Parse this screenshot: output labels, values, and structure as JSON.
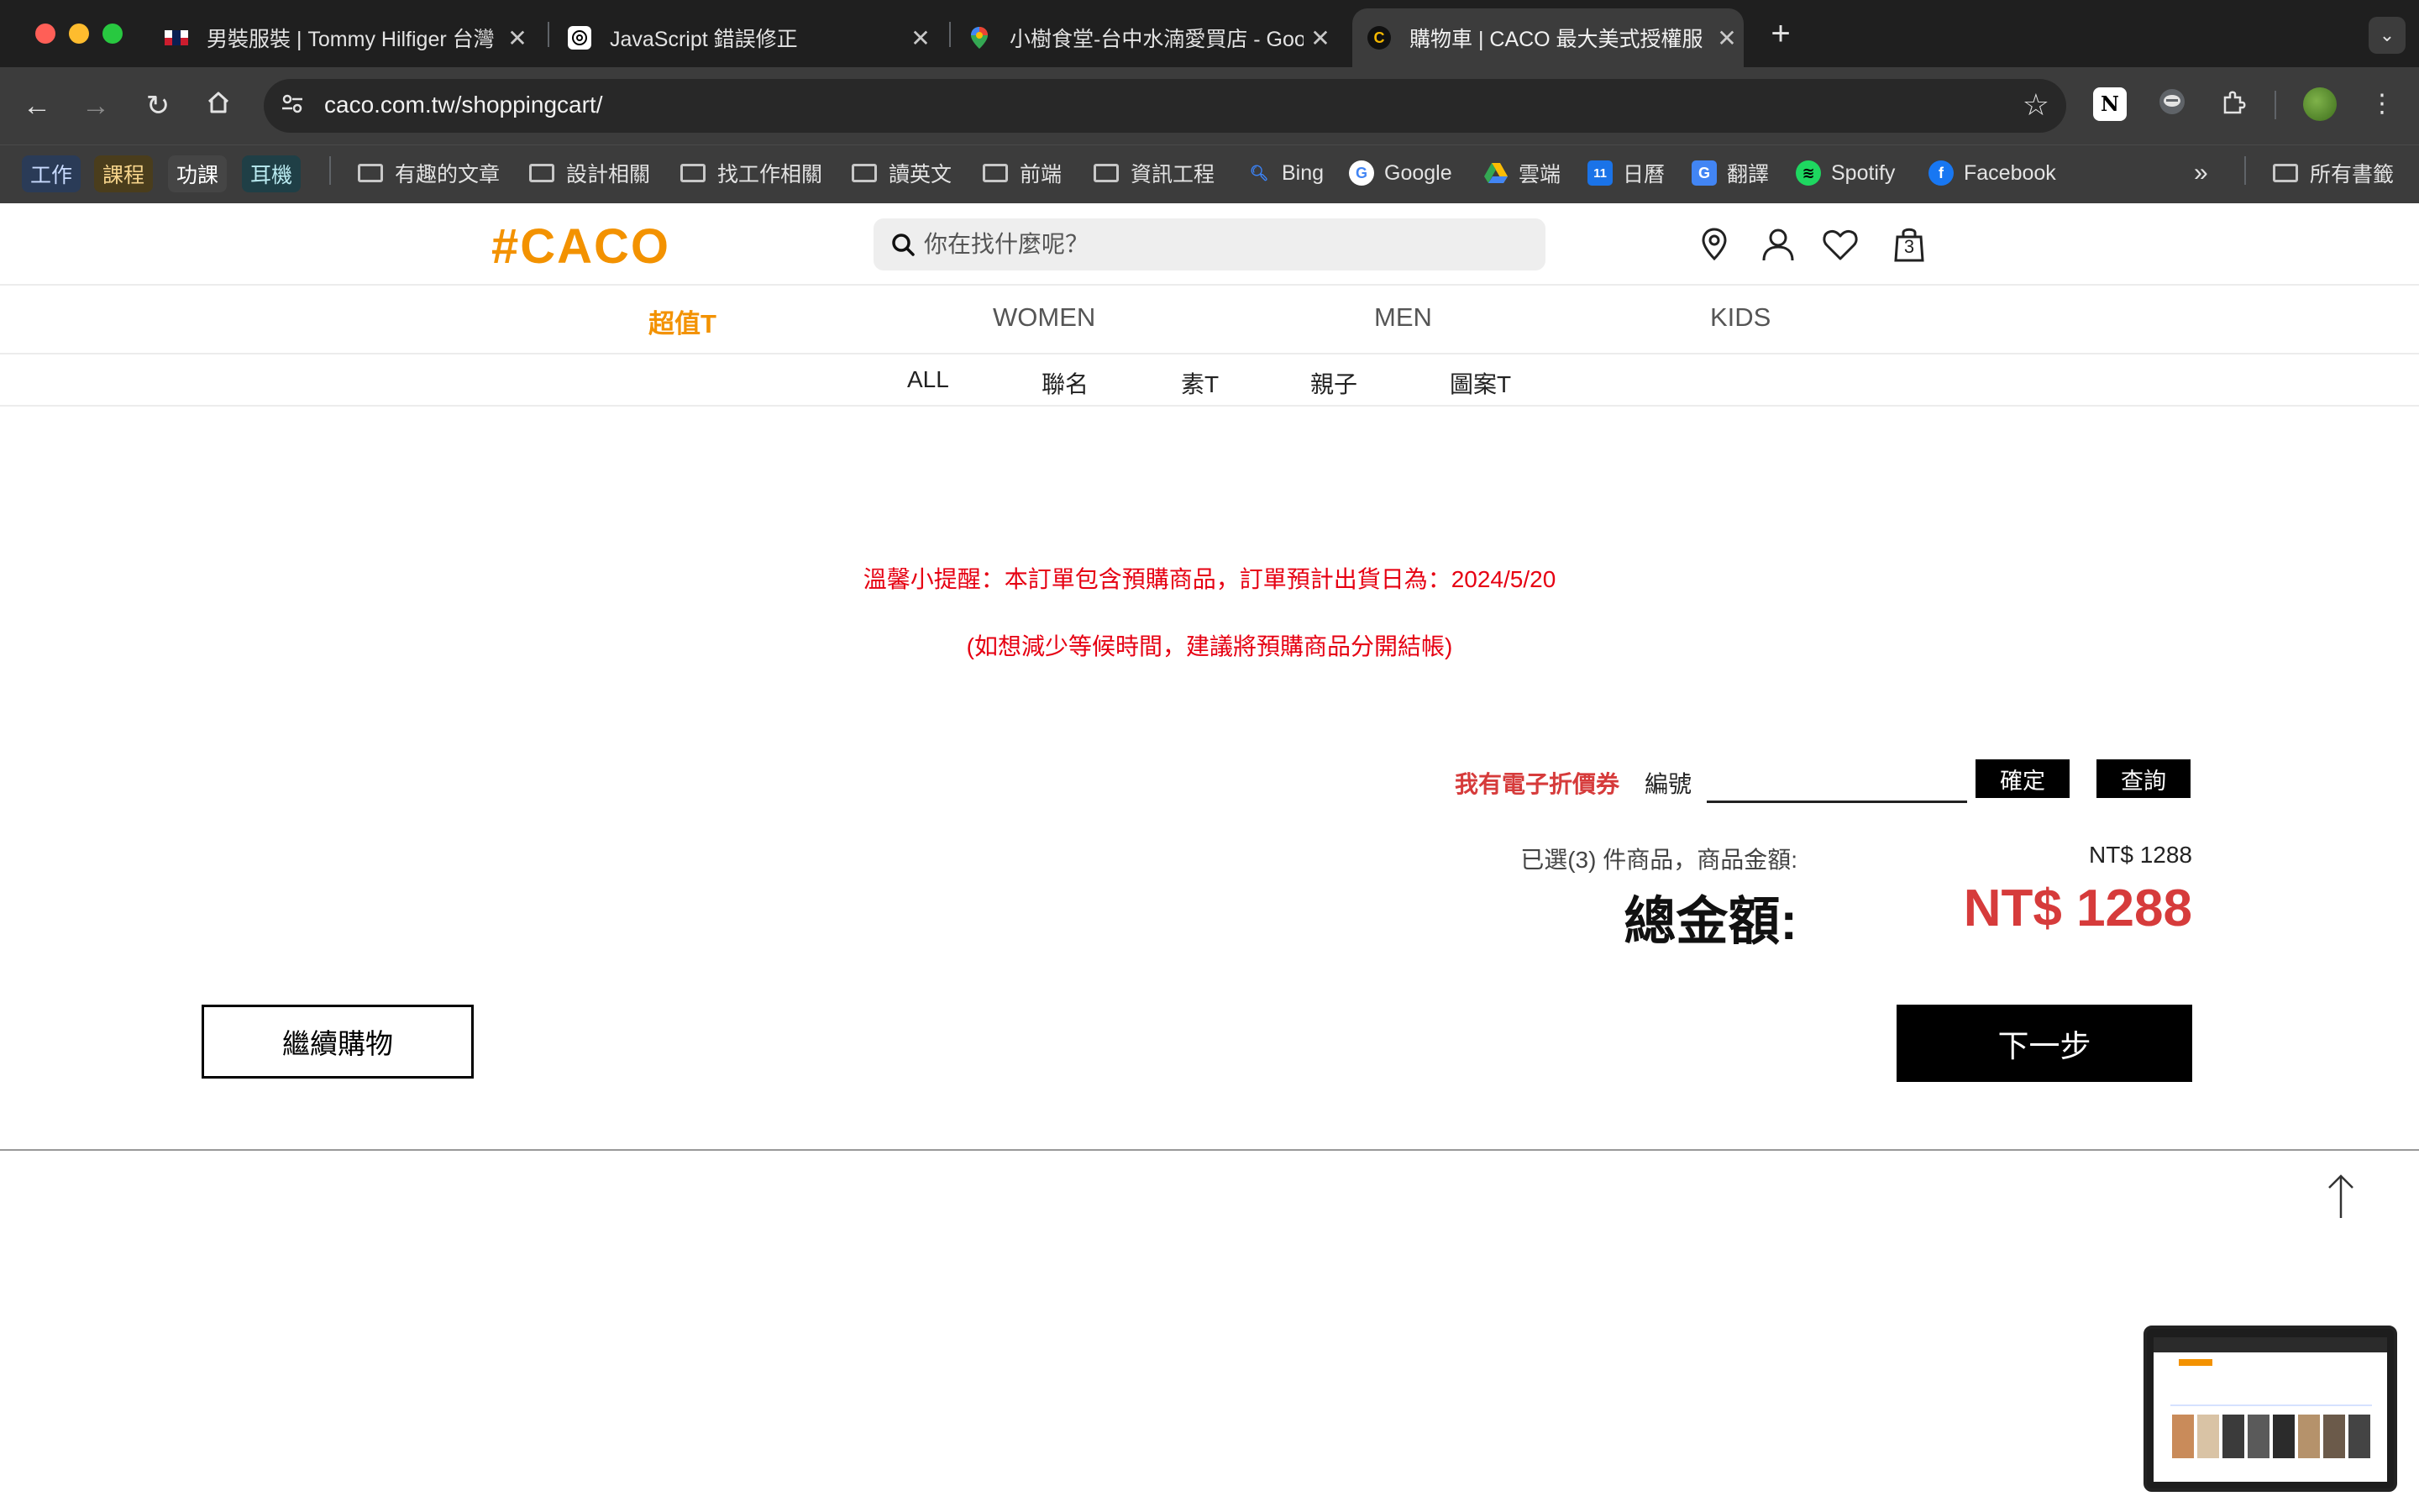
{
  "browser": {
    "tabs": [
      {
        "title": "男裝服裝 | Tommy Hilfiger 台灣",
        "favicon": "tommy-flag-icon"
      },
      {
        "title": "JavaScript 錯誤修正",
        "favicon": "chatgpt-icon"
      },
      {
        "title": "小樹食堂-台中水湳愛買店 - Goo",
        "favicon": "maps-pin-icon"
      },
      {
        "title": "購物車 | CACO 最大美式授權服",
        "favicon": "caco-icon",
        "active": true
      }
    ],
    "url": "caco.com.tw/shoppingcart/",
    "bookmarks": {
      "tags": [
        "工作",
        "課程",
        "功課",
        "耳機"
      ],
      "folders": [
        "有趣的文章",
        "設計相關",
        "找工作相關",
        "讀英文",
        "前端",
        "資訊工程"
      ],
      "links": [
        "Bing",
        "Google",
        "雲端",
        "日曆",
        "翻譯",
        "Spotify",
        "Facebook"
      ],
      "all_bookmarks": "所有書籤",
      "calendar_day": "11"
    }
  },
  "site": {
    "logo": "#CACO",
    "search_placeholder": "你在找什麼呢？",
    "cart_count": "3",
    "main_nav": [
      "超值T",
      "WOMEN",
      "MEN",
      "KIDS"
    ],
    "sub_nav": [
      "ALL",
      "聯名",
      "素T",
      "親子",
      "圖案T"
    ],
    "accent_color": "#f39200"
  },
  "cart": {
    "notice_1": "溫馨小提醒：本訂單包含預購商品，訂單預計出貨日為：2024/5/20",
    "notice_2": "(如想減少等候時間，建議將預購商品分開結帳)",
    "coupon_label": "我有電子折價券",
    "coupon_number_label": "編號",
    "confirm_btn": "確定",
    "query_btn": "查詢",
    "summary_label": "已選(3) 件商品，商品金額:",
    "summary_amount": "NT$ 1288",
    "total_label": "總金額:",
    "total_amount": "NT$ 1288",
    "continue_btn": "繼續購物",
    "next_btn": "下一步"
  }
}
